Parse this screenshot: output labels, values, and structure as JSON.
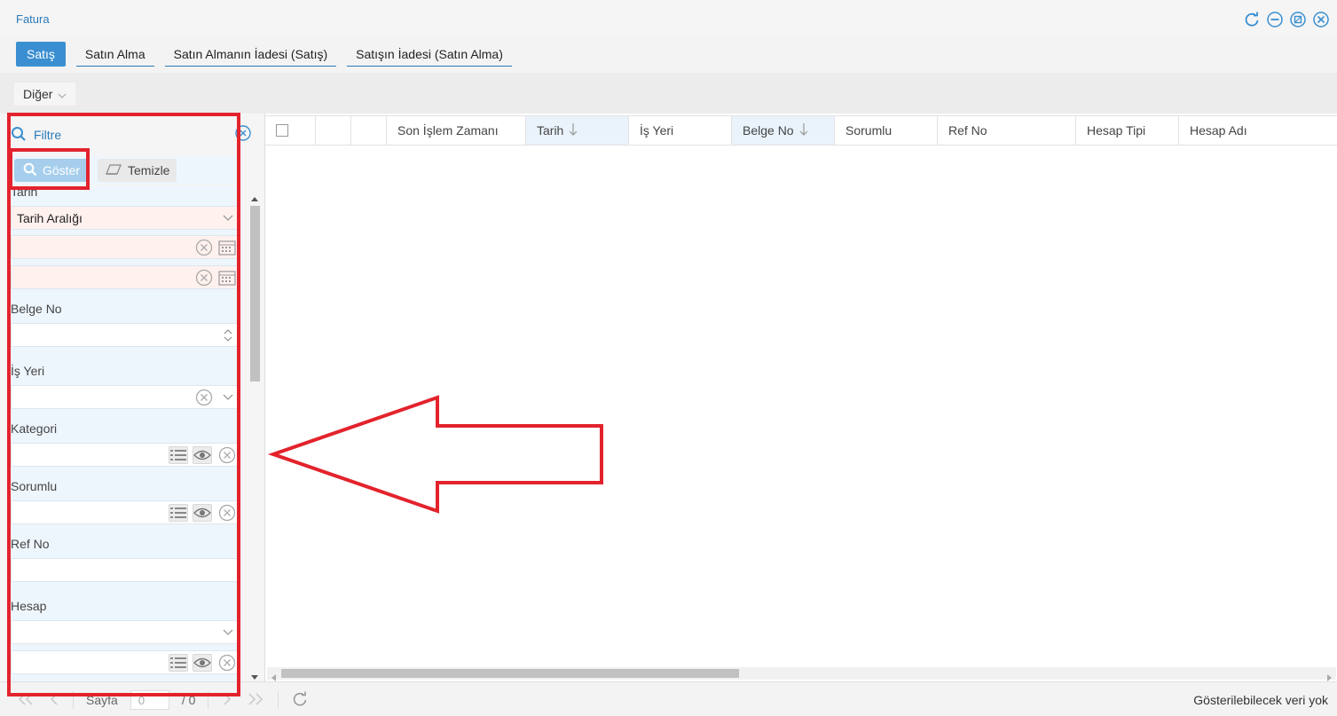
{
  "window": {
    "title": "Fatura"
  },
  "tabs": [
    {
      "label": "Satış",
      "active": true
    },
    {
      "label": "Satın Alma",
      "active": false
    },
    {
      "label": "Satın Almanın İadesi (Satış)",
      "active": false
    },
    {
      "label": "Satışın İadesi (Satın Alma)",
      "active": false
    }
  ],
  "toolbar": {
    "other_label": "Diğer"
  },
  "filter": {
    "title": "Filtre",
    "show_button": "Göster",
    "clear_button": "Temizle",
    "date_label": "Tarih",
    "date_range_value": "Tarih Aralığı",
    "doc_no_label": "Belge No",
    "workplace_label": "İş Yeri",
    "category_label": "Kategori",
    "responsible_label": "Sorumlu",
    "ref_no_label": "Ref No",
    "account_label": "Hesap"
  },
  "grid": {
    "columns": [
      {
        "label": "",
        "type": "checkbox"
      },
      {
        "label": ""
      },
      {
        "label": ""
      },
      {
        "label": "Son İşlem Zamanı"
      },
      {
        "label": "Tarih",
        "sorted": "desc"
      },
      {
        "label": "İş Yeri"
      },
      {
        "label": "Belge No",
        "sorted": "desc"
      },
      {
        "label": "Sorumlu"
      },
      {
        "label": "Ref No"
      },
      {
        "label": "Hesap Tipi"
      },
      {
        "label": "Hesap Adı"
      }
    ],
    "rows": []
  },
  "footer": {
    "page_label": "Sayfa",
    "page_value": "0",
    "page_total": "/ 0",
    "status": "Gösterilebilecek veri yok"
  },
  "colors": {
    "accent": "#3a8fd0",
    "annotation": "#e3232c",
    "filter_bg": "#eef6fd"
  }
}
